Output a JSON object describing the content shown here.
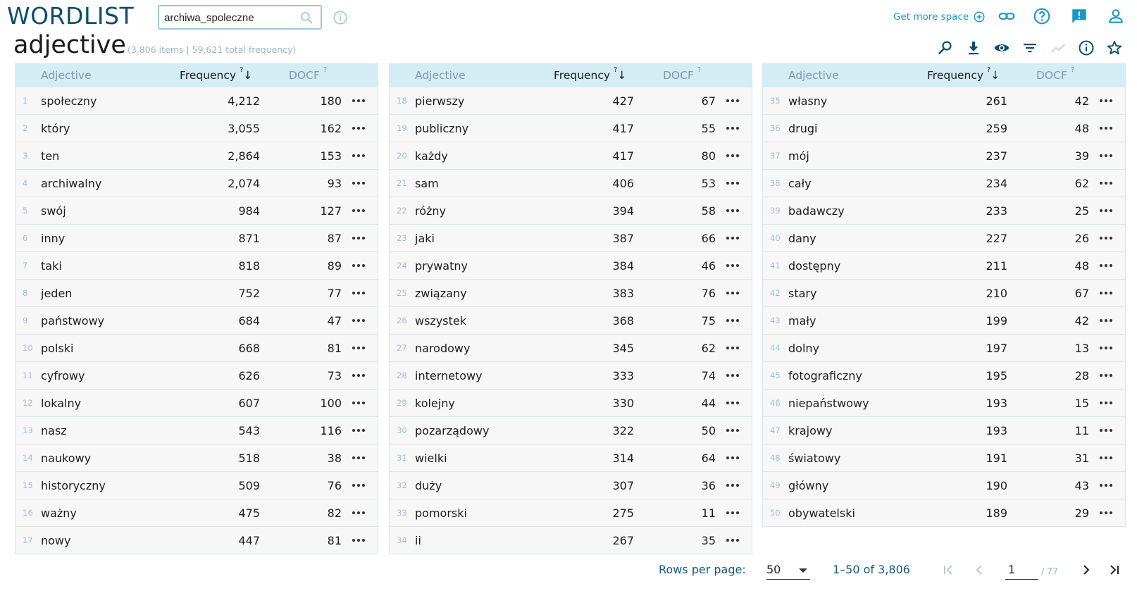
{
  "app": {
    "title": "WORDLIST"
  },
  "search": {
    "value": "archiwa_spoleczne"
  },
  "header_actions": {
    "get_more_space": "Get more space"
  },
  "page": {
    "title": "adjective",
    "summary": "(3,806 items | 59,621 total frequency)"
  },
  "table_headers": {
    "word": "Adjective",
    "frequency": "Frequency",
    "frequency_sup": "?",
    "sort_arrow": "↓",
    "docf": "DOCF",
    "docf_sup": "?"
  },
  "columns": [
    {
      "rows": [
        {
          "n": "1",
          "word": "społeczny",
          "freq": "4,212",
          "docf": "180"
        },
        {
          "n": "2",
          "word": "który",
          "freq": "3,055",
          "docf": "162"
        },
        {
          "n": "3",
          "word": "ten",
          "freq": "2,864",
          "docf": "153"
        },
        {
          "n": "4",
          "word": "archiwalny",
          "freq": "2,074",
          "docf": "93"
        },
        {
          "n": "5",
          "word": "swój",
          "freq": "984",
          "docf": "127"
        },
        {
          "n": "6",
          "word": "inny",
          "freq": "871",
          "docf": "87"
        },
        {
          "n": "7",
          "word": "taki",
          "freq": "818",
          "docf": "89"
        },
        {
          "n": "8",
          "word": "jeden",
          "freq": "752",
          "docf": "77"
        },
        {
          "n": "9",
          "word": "państwowy",
          "freq": "684",
          "docf": "47"
        },
        {
          "n": "10",
          "word": "polski",
          "freq": "668",
          "docf": "81"
        },
        {
          "n": "11",
          "word": "cyfrowy",
          "freq": "626",
          "docf": "73"
        },
        {
          "n": "12",
          "word": "lokalny",
          "freq": "607",
          "docf": "100"
        },
        {
          "n": "13",
          "word": "nasz",
          "freq": "543",
          "docf": "116"
        },
        {
          "n": "14",
          "word": "naukowy",
          "freq": "518",
          "docf": "38"
        },
        {
          "n": "15",
          "word": "historyczny",
          "freq": "509",
          "docf": "76"
        },
        {
          "n": "16",
          "word": "ważny",
          "freq": "475",
          "docf": "82"
        },
        {
          "n": "17",
          "word": "nowy",
          "freq": "447",
          "docf": "81"
        }
      ]
    },
    {
      "rows": [
        {
          "n": "18",
          "word": "pierwszy",
          "freq": "427",
          "docf": "67"
        },
        {
          "n": "19",
          "word": "publiczny",
          "freq": "417",
          "docf": "55"
        },
        {
          "n": "20",
          "word": "każdy",
          "freq": "417",
          "docf": "80"
        },
        {
          "n": "21",
          "word": "sam",
          "freq": "406",
          "docf": "53"
        },
        {
          "n": "22",
          "word": "różny",
          "freq": "394",
          "docf": "58"
        },
        {
          "n": "23",
          "word": "jaki",
          "freq": "387",
          "docf": "66"
        },
        {
          "n": "24",
          "word": "prywatny",
          "freq": "384",
          "docf": "46"
        },
        {
          "n": "25",
          "word": "związany",
          "freq": "383",
          "docf": "76"
        },
        {
          "n": "26",
          "word": "wszystek",
          "freq": "368",
          "docf": "75"
        },
        {
          "n": "27",
          "word": "narodowy",
          "freq": "345",
          "docf": "62"
        },
        {
          "n": "28",
          "word": "internetowy",
          "freq": "333",
          "docf": "74"
        },
        {
          "n": "29",
          "word": "kolejny",
          "freq": "330",
          "docf": "44"
        },
        {
          "n": "30",
          "word": "pozarządowy",
          "freq": "322",
          "docf": "50"
        },
        {
          "n": "31",
          "word": "wielki",
          "freq": "314",
          "docf": "64"
        },
        {
          "n": "32",
          "word": "duży",
          "freq": "307",
          "docf": "36"
        },
        {
          "n": "33",
          "word": "pomorski",
          "freq": "275",
          "docf": "11"
        },
        {
          "n": "34",
          "word": "ii",
          "freq": "267",
          "docf": "35"
        }
      ]
    },
    {
      "rows": [
        {
          "n": "35",
          "word": "własny",
          "freq": "261",
          "docf": "42"
        },
        {
          "n": "36",
          "word": "drugi",
          "freq": "259",
          "docf": "48"
        },
        {
          "n": "37",
          "word": "mój",
          "freq": "237",
          "docf": "39"
        },
        {
          "n": "38",
          "word": "cały",
          "freq": "234",
          "docf": "62"
        },
        {
          "n": "39",
          "word": "badawczy",
          "freq": "233",
          "docf": "25"
        },
        {
          "n": "40",
          "word": "dany",
          "freq": "227",
          "docf": "26"
        },
        {
          "n": "41",
          "word": "dostępny",
          "freq": "211",
          "docf": "48"
        },
        {
          "n": "42",
          "word": "stary",
          "freq": "210",
          "docf": "67"
        },
        {
          "n": "43",
          "word": "mały",
          "freq": "199",
          "docf": "42"
        },
        {
          "n": "44",
          "word": "dolny",
          "freq": "197",
          "docf": "13"
        },
        {
          "n": "45",
          "word": "fotograficzny",
          "freq": "195",
          "docf": "28"
        },
        {
          "n": "46",
          "word": "niepaństwowy",
          "freq": "193",
          "docf": "15"
        },
        {
          "n": "47",
          "word": "krajowy",
          "freq": "193",
          "docf": "11"
        },
        {
          "n": "48",
          "word": "światowy",
          "freq": "191",
          "docf": "31"
        },
        {
          "n": "49",
          "word": "główny",
          "freq": "190",
          "docf": "43"
        },
        {
          "n": "50",
          "word": "obywatelski",
          "freq": "189",
          "docf": "29"
        }
      ]
    }
  ],
  "pagination": {
    "rows_per_page_label": "Rows per page:",
    "rows_per_page": "50",
    "range": "1–50 of 3,806",
    "page": "1",
    "total_pages": "/ 77"
  },
  "colors": {
    "brand": "#0b4f6c",
    "accent": "#1a97c6",
    "header_bg": "#d4edf5"
  }
}
